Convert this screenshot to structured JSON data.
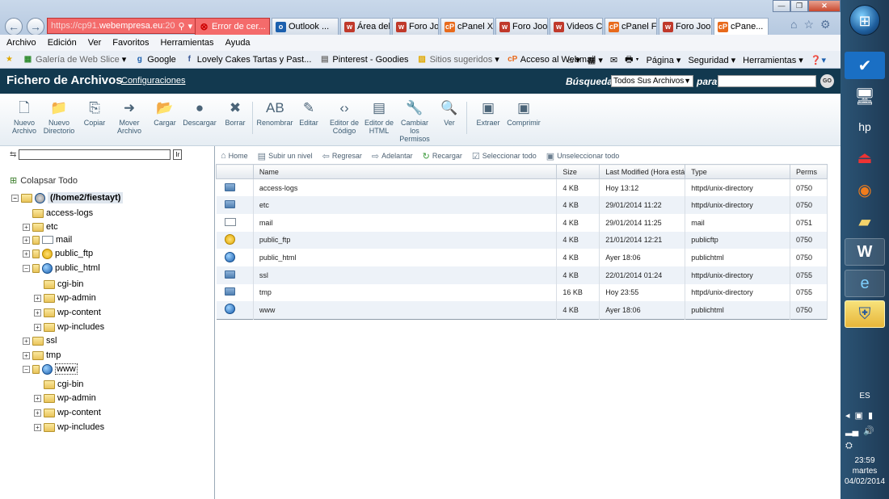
{
  "browser": {
    "address_prefix": "https://cp91.",
    "address_domain": "webempresa.eu",
    "address_suffix": ":20",
    "tabs": [
      {
        "label": "Error de cer...",
        "icon": "x",
        "kind": "err"
      },
      {
        "label": "Outlook ...",
        "icon": "o",
        "kind": "normal"
      },
      {
        "label": "Área del ...",
        "icon": "w",
        "kind": "normal"
      },
      {
        "label": "Foro Joo...",
        "icon": "w",
        "kind": "normal"
      },
      {
        "label": "cPanel X ...",
        "icon": "cp",
        "kind": "normal"
      },
      {
        "label": "Foro Joo...",
        "icon": "w",
        "kind": "normal"
      },
      {
        "label": "Videos C...",
        "icon": "w",
        "kind": "normal"
      },
      {
        "label": "cPanel Fi...",
        "icon": "cp",
        "kind": "normal"
      },
      {
        "label": "Foro Joo...",
        "icon": "w",
        "kind": "normal"
      },
      {
        "label": "cPane...",
        "icon": "cp",
        "kind": "active"
      }
    ],
    "menu": [
      "Archivo",
      "Edición",
      "Ver",
      "Favoritos",
      "Herramientas",
      "Ayuda"
    ],
    "favorites": [
      {
        "label": "Galería de Web Slice",
        "caret": "▾",
        "grey": true
      },
      {
        "label": "Google",
        "caret": "",
        "grey": false
      },
      {
        "label": "Lovely Cakes Tartas y Past...",
        "caret": "",
        "grey": false
      },
      {
        "label": "Pinterest - Goodies",
        "caret": "",
        "grey": false
      },
      {
        "label": "Sitios sugeridos",
        "caret": "▾",
        "grey": true
      },
      {
        "label": "Acceso al Webmail",
        "caret": "",
        "grey": false
      }
    ],
    "command_bar": {
      "pagina": "Página",
      "seguridad": "Seguridad",
      "herramientas": "Herramientas"
    }
  },
  "fm": {
    "title": "Fichero de Archivos",
    "config_link": "Configuraciones",
    "search_label": "Búsqueda",
    "search_scope": "Todos Sus Archivos",
    "search_for": "para",
    "go_label": "GO"
  },
  "toolbar": [
    {
      "line1": "Nuevo",
      "line2": "Archivo",
      "line3": "",
      "icon": "new-file-icon",
      "glyph": "🗋"
    },
    {
      "line1": "Nuevo",
      "line2": "Directorio",
      "line3": "",
      "icon": "new-folder-icon",
      "glyph": "📁"
    },
    {
      "line1": "Copiar",
      "line2": "",
      "line3": "",
      "icon": "copy-icon",
      "glyph": "⎘"
    },
    {
      "line1": "Mover",
      "line2": "Archivo",
      "line3": "",
      "icon": "move-icon",
      "glyph": "➜"
    },
    {
      "line1": "Cargar",
      "line2": "",
      "line3": "",
      "icon": "upload-icon",
      "glyph": "📂"
    },
    {
      "line1": "Descargar",
      "line2": "",
      "line3": "",
      "icon": "download-icon",
      "glyph": "●"
    },
    {
      "line1": "Borrar",
      "line2": "",
      "line3": "",
      "icon": "delete-icon",
      "glyph": "✖"
    },
    {
      "line1": "Renombrar",
      "line2": "",
      "line3": "",
      "icon": "rename-icon",
      "glyph": "AB"
    },
    {
      "line1": "Editar",
      "line2": "",
      "line3": "",
      "icon": "edit-icon",
      "glyph": "✎"
    },
    {
      "line1": "Editor de",
      "line2": "Código",
      "line3": "",
      "icon": "code-editor-icon",
      "glyph": "‹›"
    },
    {
      "line1": "Editor de",
      "line2": "HTML",
      "line3": "",
      "icon": "html-editor-icon",
      "glyph": "▤"
    },
    {
      "line1": "Cambiar",
      "line2": "los",
      "line3": "Permisos",
      "icon": "permissions-icon",
      "glyph": "🔧"
    },
    {
      "line1": "Ver",
      "line2": "",
      "line3": "",
      "icon": "view-icon",
      "glyph": "🔍"
    },
    {
      "line1": "Extraer",
      "line2": "",
      "line3": "",
      "icon": "extract-icon",
      "glyph": "▣"
    },
    {
      "line1": "Comprimir",
      "line2": "",
      "line3": "",
      "icon": "compress-icon",
      "glyph": "▣"
    }
  ],
  "tree": {
    "collapse_all": "Colapsar Todo",
    "nodes": [
      {
        "label": "(/home2/fiestayt)",
        "icon": "home",
        "exp": "−",
        "root": true
      },
      {
        "label": "access-logs",
        "icon": "folder",
        "exp": ""
      },
      {
        "label": "etc",
        "icon": "folder",
        "exp": "+"
      },
      {
        "label": "mail",
        "icon": "mail",
        "exp": "+"
      },
      {
        "label": "public_ftp",
        "icon": "ftp",
        "exp": "+"
      },
      {
        "label": "public_html",
        "icon": "globe",
        "exp": "−"
      },
      {
        "label": "cgi-bin",
        "icon": "folder",
        "exp": ""
      },
      {
        "label": "wp-admin",
        "icon": "folder",
        "exp": "+"
      },
      {
        "label": "wp-content",
        "icon": "folder",
        "exp": "+"
      },
      {
        "label": "wp-includes",
        "icon": "folder",
        "exp": "+"
      },
      {
        "label": "ssl",
        "icon": "folder",
        "exp": "+"
      },
      {
        "label": "tmp",
        "icon": "folder",
        "exp": "+"
      },
      {
        "label": "www",
        "icon": "globe",
        "exp": "−",
        "sel": true
      },
      {
        "label": "cgi-bin",
        "icon": "folder",
        "exp": ""
      },
      {
        "label": "wp-admin",
        "icon": "folder",
        "exp": "+"
      },
      {
        "label": "wp-content",
        "icon": "folder",
        "exp": "+"
      },
      {
        "label": "wp-includes",
        "icon": "folder",
        "exp": "+"
      }
    ]
  },
  "nav": {
    "home": "Home",
    "up": "Subir un nivel",
    "back": "Regresar",
    "forward": "Adelantar",
    "reload": "Recargar",
    "select_all": "Seleccionar todo",
    "unselect_all": "Unseleccionar todo"
  },
  "table": {
    "headers": {
      "name": "Name",
      "size": "Size",
      "modified": "Last Modified (Hora está",
      "type": "Type",
      "perms": "Perms"
    },
    "rows": [
      {
        "icon": "folder",
        "name": "access-logs",
        "size": "4 KB",
        "modified": "Hoy 13:12",
        "type": "httpd/unix-directory",
        "perms": "0750"
      },
      {
        "icon": "folder",
        "name": "etc",
        "size": "4 KB",
        "modified": "29/01/2014 11:22",
        "type": "httpd/unix-directory",
        "perms": "0750"
      },
      {
        "icon": "mail",
        "name": "mail",
        "size": "4 KB",
        "modified": "29/01/2014 11:25",
        "type": "mail",
        "perms": "0751"
      },
      {
        "icon": "ftp",
        "name": "public_ftp",
        "size": "4 KB",
        "modified": "21/01/2014 12:21",
        "type": "publicftp",
        "perms": "0750"
      },
      {
        "icon": "globe",
        "name": "public_html",
        "size": "4 KB",
        "modified": "Ayer 18:06",
        "type": "publichtml",
        "perms": "0750"
      },
      {
        "icon": "folder",
        "name": "ssl",
        "size": "4 KB",
        "modified": "22/01/2014 01:24",
        "type": "httpd/unix-directory",
        "perms": "0755"
      },
      {
        "icon": "folder",
        "name": "tmp",
        "size": "16 KB",
        "modified": "Hoy 23:55",
        "type": "httpd/unix-directory",
        "perms": "0755"
      },
      {
        "icon": "globe",
        "name": "www",
        "size": "4 KB",
        "modified": "Ayer 18:06",
        "type": "publichtml",
        "perms": "0750"
      }
    ]
  },
  "taskbar": {
    "lang": "ES",
    "time": "23:59",
    "day": "martes",
    "date": "04/02/2014"
  },
  "colors": {
    "fm_header": "#12394f",
    "error_tab": "#f46b6b",
    "row_alt": "#edf2f8"
  }
}
